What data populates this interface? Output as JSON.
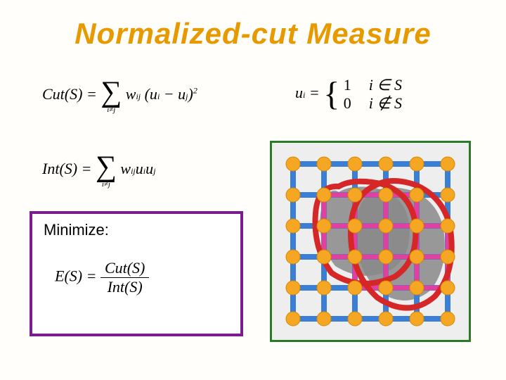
{
  "title": "Normalized-cut Measure",
  "eq_cut_lhs": "Cut(S) =",
  "eq_cut_sumbelow": "i≠j",
  "eq_cut_rhs_w": "w",
  "eq_cut_rhs_wsub": "ij",
  "eq_cut_rhs_open": "(u",
  "eq_cut_rhs_i": "i",
  "eq_cut_rhs_minus": " − u",
  "eq_cut_rhs_j": "j",
  "eq_cut_rhs_close": ")",
  "eq_cut_rhs_sq": "2",
  "eq_ui_lhs": "u",
  "eq_ui_sub": "i",
  "eq_ui_eq": " =",
  "eq_ui_case1_val": "1",
  "eq_ui_case1_cond": "i ∈ S",
  "eq_ui_case2_val": "0",
  "eq_ui_case2_cond": "i ∉ S",
  "eq_int_lhs": "Int(S) =",
  "eq_int_sumbelow": "i≠j",
  "eq_int_w": "w",
  "eq_int_wsub": "ij",
  "eq_int_u1": "u",
  "eq_int_u1sub": "i",
  "eq_int_u2": "u",
  "eq_int_u2sub": "j",
  "minimize_label": "Minimize:",
  "eq_E_lhs": "E(S) =",
  "eq_E_num": "Cut(S)",
  "eq_E_den": "Int(S)",
  "chart_data": {
    "type": "diagram",
    "description": "6x6 grid graph with two irregular region cuts",
    "grid_rows": 6,
    "grid_cols": 6,
    "node_color": "#f5a623",
    "edge_color": "#3a7fd5",
    "cut_color": "#d62728",
    "region_fill": "#888888",
    "region_edge_color": "#e040a0",
    "regions": [
      {
        "bounds": "approx cols 1-4 rows 1-4 irregular blob"
      },
      {
        "bounds": "approx cols 2-5 rows 1-5 irregular blob overlapping"
      }
    ]
  }
}
